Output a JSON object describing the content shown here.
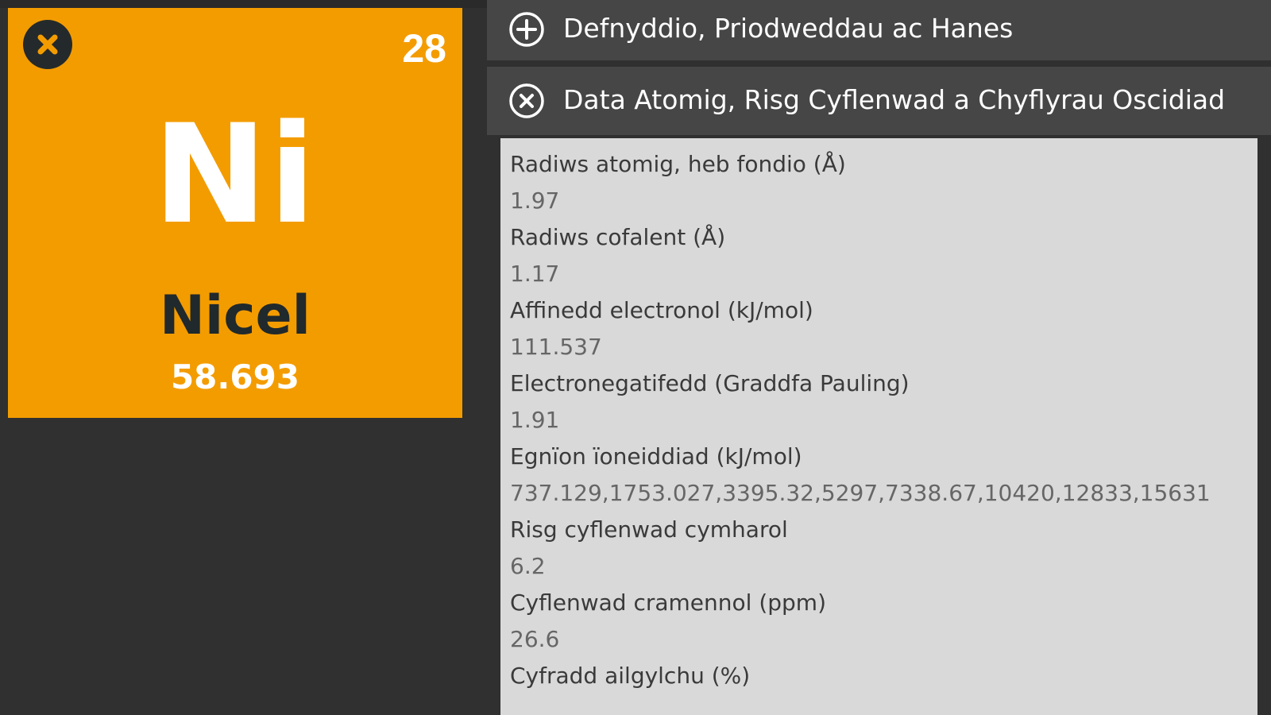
{
  "element": {
    "atomic_number": "28",
    "symbol": "Ni",
    "name": "Nicel",
    "atomic_mass": "58.693",
    "tile_color": "#f39c00",
    "close_icon": "close-circle-icon"
  },
  "accordion": {
    "section_1": {
      "label": "Defnyddio, Priodweddau ac Hanes",
      "icon": "plus-circle-icon",
      "state": "collapsed"
    },
    "section_2": {
      "label": "Data Atomig, Risg Cyflenwad a Chyflyrau Oscidiad",
      "icon": "close-circle-icon",
      "state": "expanded"
    }
  },
  "atomic_data": [
    {
      "label": "Radiws atomig, heb fondio (Å)",
      "value": "1.97"
    },
    {
      "label": "Radiws cofalent (Å)",
      "value": "1.17"
    },
    {
      "label": "Affinedd electronol (kJ/mol)",
      "value": "111.537"
    },
    {
      "label": "Electronegatifedd (Graddfa Pauling)",
      "value": "1.91"
    },
    {
      "label": "Egnïon ïoneiddiad (kJ/mol)",
      "value": "737.129,1753.027,3395.32,5297,7338.67,10420,12833,15631"
    },
    {
      "label": "Risg cyflenwad cymharol",
      "value": "6.2"
    },
    {
      "label": "Cyflenwad cramennol (ppm)",
      "value": "26.6"
    },
    {
      "label": "Cyfradd ailgylchu (%)",
      "value": ""
    }
  ],
  "colors": {
    "background": "#303030",
    "header_bar": "#464646",
    "content_panel": "#d9d9d9",
    "accent": "#f39c00"
  }
}
